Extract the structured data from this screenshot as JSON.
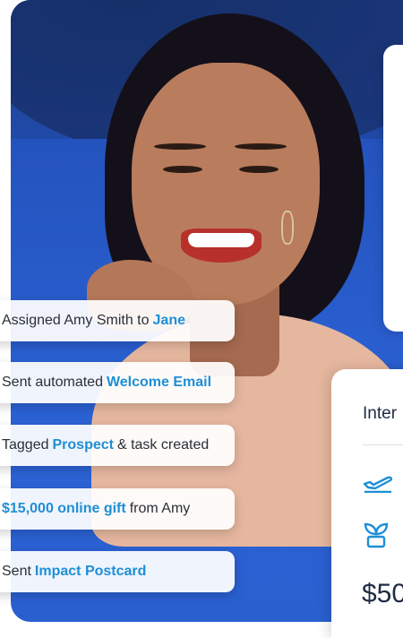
{
  "activity": [
    {
      "pre": "Assigned Amy Smith to",
      "highlight": "Jane",
      "post": ""
    },
    {
      "pre": "Sent automated",
      "highlight": "Welcome Email",
      "post": ""
    },
    {
      "pre": "Tagged",
      "highlight": "Prospect",
      "post": "& task created"
    },
    {
      "pre": "",
      "highlight": "$15,000 online gift",
      "post": "from Amy"
    },
    {
      "pre": "Sent",
      "highlight": "Impact Postcard",
      "post": ""
    }
  ],
  "card": {
    "title": "Inter",
    "amount": "$50"
  },
  "icons": {
    "plane": "airplane-takeoff-icon",
    "plant": "plant-sprout-icon"
  },
  "colors": {
    "accent": "#1e8fd6",
    "background_blue": "#2a5fcf"
  }
}
